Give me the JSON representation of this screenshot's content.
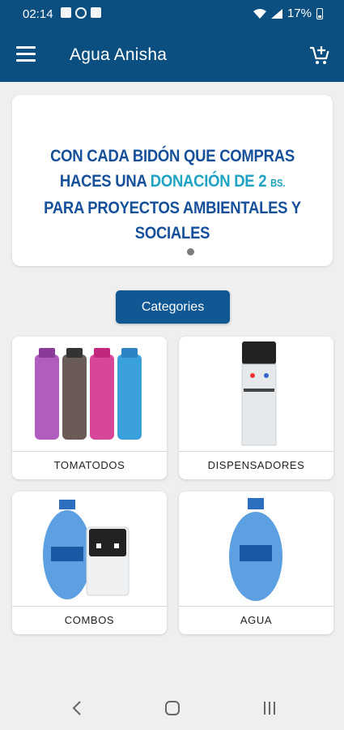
{
  "status_bar": {
    "time": "02:14",
    "battery": "17%"
  },
  "app_bar": {
    "title": "Agua Anisha",
    "menu_icon": "hamburger-menu-icon",
    "cart_icon": "add-to-cart-icon"
  },
  "banner": {
    "line1": "CON CADA BIDÓN QUE COMPRAS",
    "line2_a": "HACES UNA ",
    "line2_b": "DONACIÓN DE 2 ",
    "line2_c": "BS.",
    "line3": "PARA PROYECTOS AMBIENTALES Y SOCIALES"
  },
  "categories_button": "Categories",
  "categories": [
    {
      "label": "TOMATODOS"
    },
    {
      "label": "DISPENSADORES"
    },
    {
      "label": "COMBOS"
    },
    {
      "label": "AGUA"
    }
  ],
  "colors": {
    "primary": "#0b4f80",
    "button": "#105894",
    "banner_blue": "#16509b",
    "banner_accent": "#1fa3c4"
  }
}
